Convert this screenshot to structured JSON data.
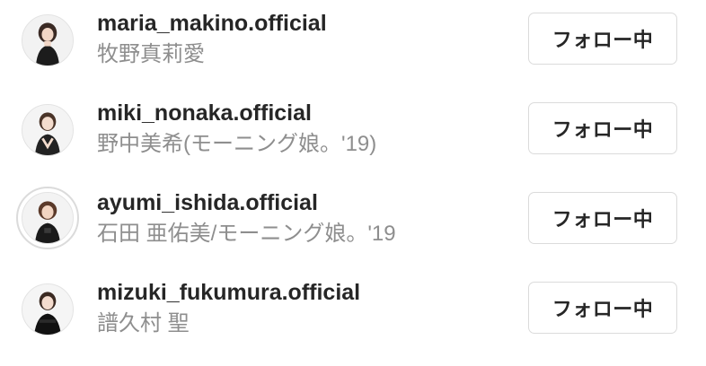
{
  "users": [
    {
      "username": "maria_makino.official",
      "fullname": "牧野真莉愛",
      "follow_label": "フォロー中",
      "avatar": "profile-photo",
      "has_story_ring": false
    },
    {
      "username": "miki_nonaka.official",
      "fullname": "野中美希(モーニング娘。'19)",
      "follow_label": "フォロー中",
      "avatar": "profile-photo",
      "has_story_ring": false
    },
    {
      "username": "ayumi_ishida.official",
      "fullname": "石田 亜佑美/モーニング娘。'19",
      "follow_label": "フォロー中",
      "avatar": "profile-photo",
      "has_story_ring": true
    },
    {
      "username": "mizuki_fukumura.official",
      "fullname": "譜久村 聖",
      "follow_label": "フォロー中",
      "avatar": "profile-photo",
      "has_story_ring": false
    }
  ]
}
